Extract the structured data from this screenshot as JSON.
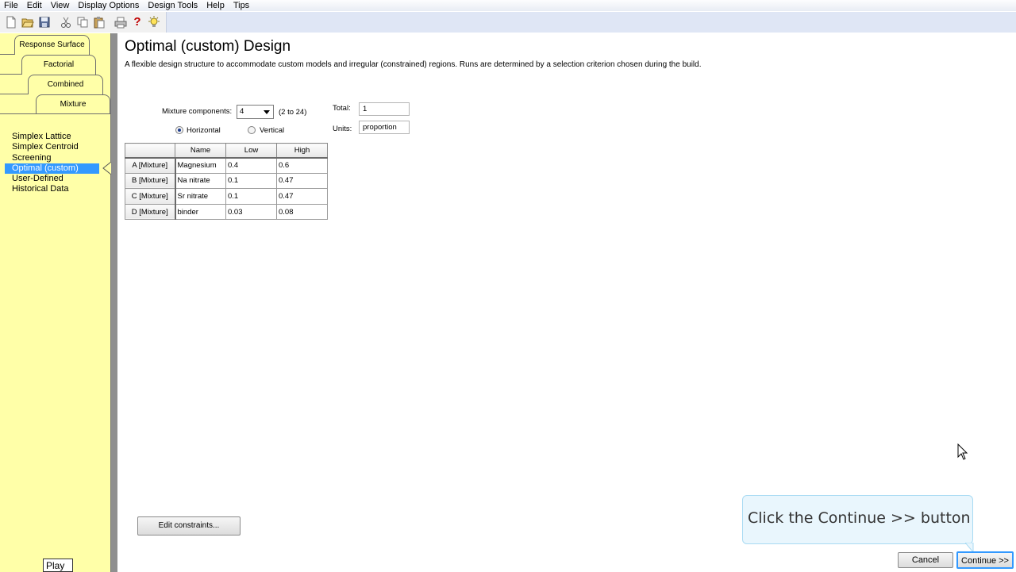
{
  "menubar": {
    "items": [
      "File",
      "Edit",
      "View",
      "Display Options",
      "Design Tools",
      "Help",
      "Tips"
    ]
  },
  "toolbar": {
    "icons": [
      "new-icon",
      "open-icon",
      "save-icon",
      "cut-icon",
      "copy-icon",
      "paste-icon",
      "print-icon",
      "help-icon",
      "tips-icon"
    ],
    "help_glyph": "?"
  },
  "sidebar": {
    "tabs": [
      "Response Surface",
      "Factorial",
      "Combined",
      "Mixture"
    ],
    "designs": [
      "Simplex Lattice",
      "Simplex Centroid",
      "Screening",
      "Optimal (custom)",
      "User-Defined",
      "Historical Data"
    ],
    "selected": "Optimal (custom)",
    "background": "#ffffa8"
  },
  "main": {
    "title": "Optimal (custom) Design",
    "description": "A flexible design structure to accommodate custom models and irregular (constrained) regions.  Runs are determined by a selection criterion chosen during the build.",
    "components_label": "Mixture components:",
    "components_value": "4",
    "components_range": "(2 to 24)",
    "total_label": "Total:",
    "total_value": "1",
    "units_label": "Units:",
    "units_value": "proportion",
    "orientation": {
      "horizontal": "Horizontal",
      "vertical": "Vertical",
      "selected": "Horizontal"
    },
    "table": {
      "headers": [
        "",
        "Name",
        "Low",
        "High"
      ],
      "rows": [
        [
          "A [Mixture]",
          "Magnesium",
          "0.4",
          "0.6"
        ],
        [
          "B [Mixture]",
          "Na nitrate",
          "0.1",
          "0.47"
        ],
        [
          "C [Mixture]",
          "Sr nitrate",
          "0.1",
          "0.47"
        ],
        [
          "D [Mixture]",
          "binder",
          "0.03",
          "0.08"
        ]
      ]
    },
    "edit_constraints": "Edit constraints..."
  },
  "footer": {
    "cancel": "Cancel",
    "continue": "Continue >>"
  },
  "tutorial": {
    "callout": "Click the Continue >> button",
    "play": "Play"
  },
  "colors": {
    "selection": "#3399ff",
    "callout_bg": "#e9f6fd",
    "toolbar_bg": "#dfe6f5"
  }
}
